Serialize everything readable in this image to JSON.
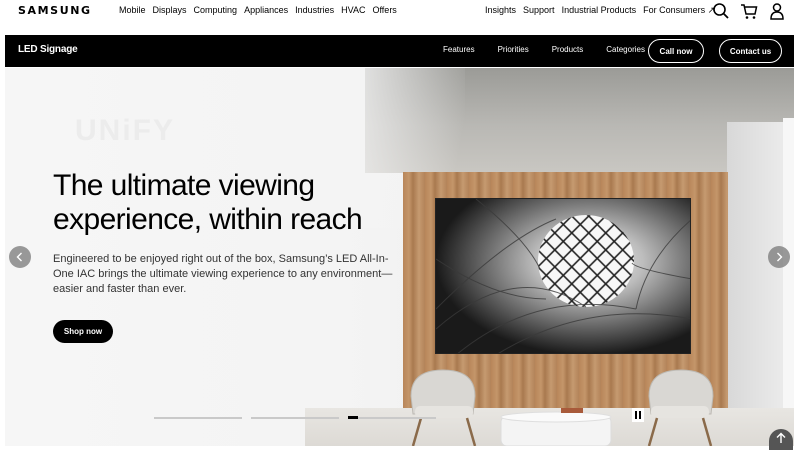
{
  "global_nav": {
    "logo": "SAMSUNG",
    "menu": [
      "Mobile",
      "Displays",
      "Computing",
      "Appliances",
      "Industries",
      "HVAC",
      "Offers"
    ],
    "right_links": [
      "Insights",
      "Support",
      "Industrial Products",
      "For Consumers ↗"
    ],
    "icons": [
      "search-icon",
      "cart-icon",
      "user-icon"
    ]
  },
  "sub_nav": {
    "title": "LED Signage",
    "links": [
      "Features",
      "Priorities",
      "Products",
      "Categories"
    ],
    "call_label": "Call now",
    "contact_label": "Contact us"
  },
  "hero": {
    "watermark": "UNiFY",
    "title": "The ultimate viewing experience, within reach",
    "description": "Engineered to be enjoyed right out of the box, Samsung’s LED All-In-One IAC brings the ultimate viewing experience to any environment—easier and faster than ever.",
    "cta_label": "Shop now",
    "slide_count": 3,
    "active_slide": 3
  },
  "colors": {
    "nav_bar": "#000000",
    "wood": "#b8865a",
    "button": "#000000"
  }
}
